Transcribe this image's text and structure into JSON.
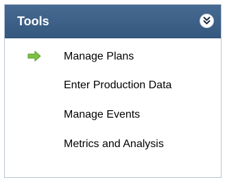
{
  "panel": {
    "title": "Tools",
    "collapse_icon": "double-chevron-down-icon",
    "items": [
      {
        "label": "Manage Plans",
        "active": true,
        "indicator_icon": "green-arrow-right-icon"
      },
      {
        "label": "Enter Production Data",
        "active": false
      },
      {
        "label": "Manage Events",
        "active": false
      },
      {
        "label": "Metrics and Analysis",
        "active": false
      }
    ]
  },
  "colors": {
    "header_bg": "#3e6189",
    "header_text": "#ffffff",
    "indicator_green": "#7cc242",
    "border": "#b9c4d2"
  }
}
